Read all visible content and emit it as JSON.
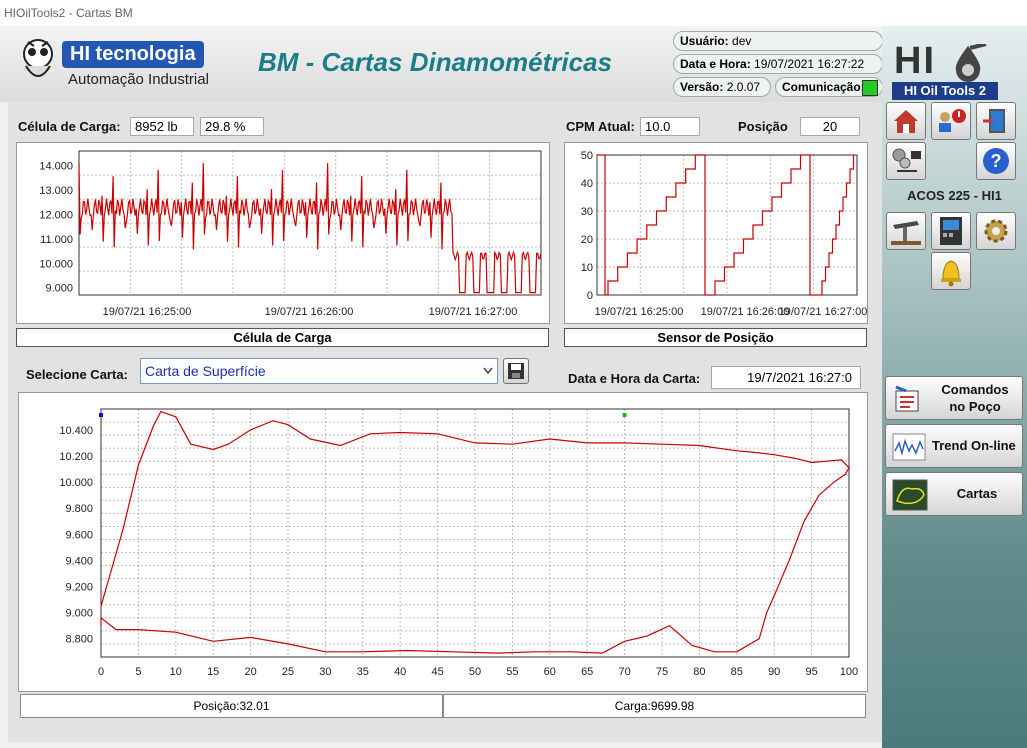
{
  "window": {
    "title": "HIOilTools2 - Cartas BM"
  },
  "header": {
    "logo_name": "HI tecnologia",
    "logo_sub": "Automação Industrial",
    "app_title": "BM - Cartas Dinamométricas",
    "user_label": "Usuário:",
    "user_value": "dev",
    "datetime_label": "Data e Hora:",
    "datetime_value": "19/07/2021 16:27:22",
    "version_label": "Versão:",
    "version_value": "2.0.07",
    "comm_label": "Comunicação:",
    "comm_status_color": "#22cc22",
    "brand_logo": "HI Oil Tools 2"
  },
  "load_cell": {
    "label": "Célula de Carga:",
    "value": "8952 lb",
    "percent": "29.8 %",
    "caption": "Célula de Carga"
  },
  "position": {
    "cpm_label": "CPM Atual:",
    "cpm_value": "10.0",
    "pos_label": "Posição",
    "pos_value": "20",
    "caption": "Sensor de Posição"
  },
  "card_select": {
    "label": "Selecione Carta:",
    "selected": "Carta de Superfície",
    "datetime_label": "Data e Hora da Carta:",
    "datetime_value": "19/7/2021 16:27:0"
  },
  "status": {
    "position": "Posição:32.01",
    "load": "Carga:9699.98"
  },
  "side": {
    "well_name": "ACOS 225 - HI1",
    "nav_commands": "Comandos\nno Poço",
    "nav_trend": "Trend On-line",
    "nav_cards": "Cartas"
  },
  "chart_data": [
    {
      "type": "line",
      "name": "load-trend",
      "x_ticks": [
        "19/07/21 16:25:00",
        "19/07/21 16:26:00",
        "19/07/21 16:27:00"
      ],
      "y_ticks": [
        "14.000",
        "13.000",
        "12.000",
        "11.000",
        "10.000",
        "9.000"
      ],
      "ylim": [
        8700,
        14600
      ],
      "color": "#cc0000"
    },
    {
      "type": "line",
      "name": "position-trend",
      "x_ticks": [
        "19/07/21 16:25:00",
        "19/07/21 16:26:00",
        "19/07/21 16:27:00"
      ],
      "y_ticks": [
        "50",
        "40",
        "30",
        "20",
        "10",
        "0"
      ],
      "ylim": [
        0,
        50
      ],
      "color": "#cc0000"
    },
    {
      "type": "line",
      "name": "surface-card",
      "x_ticks": [
        "0",
        "5",
        "10",
        "15",
        "20",
        "25",
        "30",
        "35",
        "40",
        "45",
        "50",
        "55",
        "60",
        "65",
        "70",
        "75",
        "80",
        "85",
        "90",
        "95",
        "100"
      ],
      "y_ticks": [
        "10.400",
        "10.200",
        "10.000",
        "9.800",
        "9.600",
        "9.400",
        "9.200",
        "9.000",
        "8.800"
      ],
      "xlim": [
        0,
        100
      ],
      "ylim": [
        8660,
        10560
      ],
      "color": "#cc0000",
      "x": [
        0,
        1,
        3,
        5,
        7,
        8,
        10,
        12,
        15,
        17,
        20,
        23,
        25,
        28,
        32,
        36,
        40,
        45,
        50,
        55,
        60,
        65,
        70,
        75,
        80,
        85,
        87,
        90,
        93,
        95,
        97,
        99,
        100,
        99.5,
        98,
        96,
        94,
        92,
        90,
        89,
        88,
        85,
        82,
        79,
        76,
        73,
        70,
        67,
        63,
        58,
        53,
        47,
        41,
        35,
        30,
        25,
        20,
        15,
        10,
        5,
        2,
        0,
        0
      ],
      "y": [
        9050,
        9250,
        9650,
        10130,
        10430,
        10540,
        10500,
        10290,
        10250,
        10290,
        10400,
        10470,
        10440,
        10330,
        10280,
        10370,
        10380,
        10370,
        10300,
        10290,
        10330,
        10300,
        10300,
        10290,
        10280,
        10240,
        10230,
        10210,
        10180,
        10150,
        10160,
        10170,
        10110,
        10060,
        10000,
        9900,
        9700,
        9400,
        9130,
        9000,
        8800,
        8700,
        8700,
        8750,
        8900,
        8820,
        8780,
        8690,
        8700,
        8700,
        8690,
        8700,
        8710,
        8700,
        8700,
        8760,
        8810,
        8780,
        8850,
        8870,
        8870,
        8960,
        8900
      ]
    }
  ]
}
